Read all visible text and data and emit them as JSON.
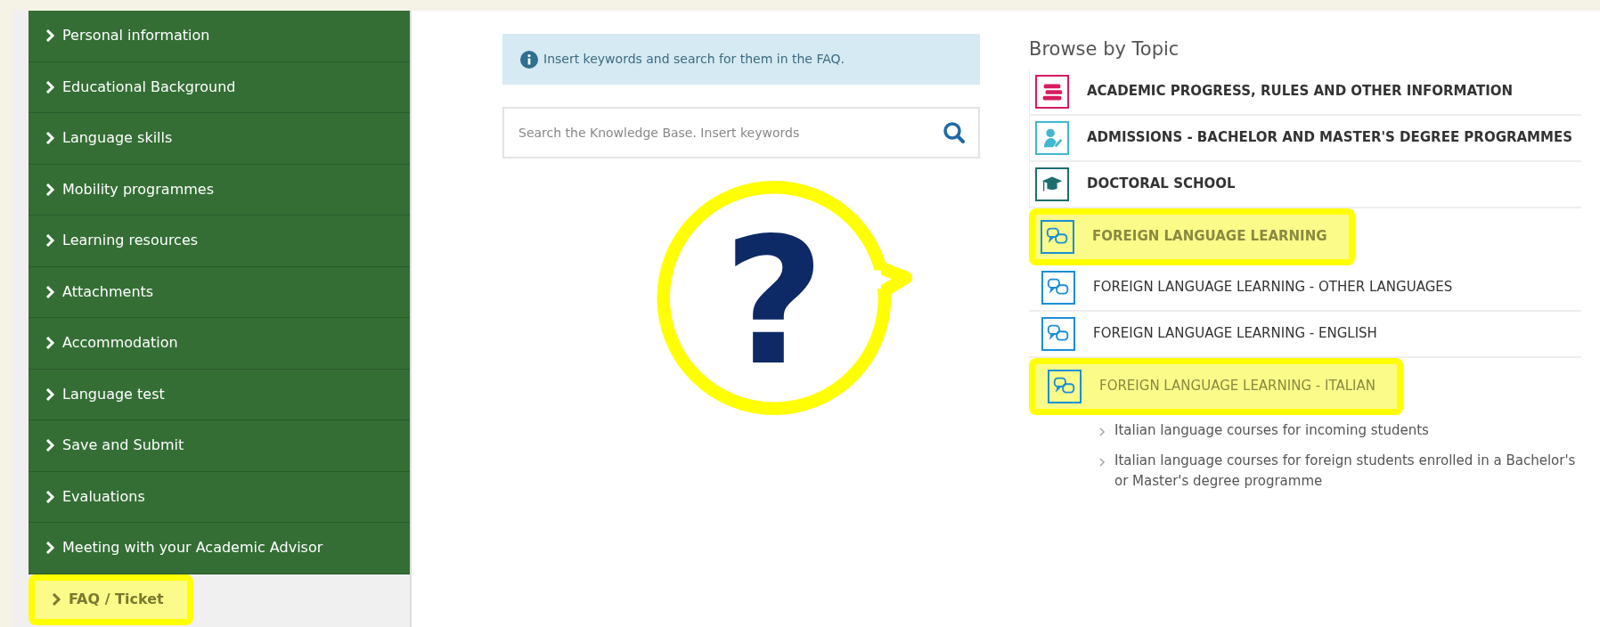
{
  "sidebar": {
    "items": [
      {
        "label": "Personal information",
        "selected": false,
        "highlighted": false
      },
      {
        "label": "Educational Background",
        "selected": false,
        "highlighted": false
      },
      {
        "label": "Language skills",
        "selected": false,
        "highlighted": false
      },
      {
        "label": "Mobility programmes",
        "selected": false,
        "highlighted": false
      },
      {
        "label": "Learning resources",
        "selected": false,
        "highlighted": false
      },
      {
        "label": "Attachments",
        "selected": false,
        "highlighted": false
      },
      {
        "label": "Accommodation",
        "selected": false,
        "highlighted": false
      },
      {
        "label": "Language test",
        "selected": false,
        "highlighted": false
      },
      {
        "label": "Save and Submit",
        "selected": false,
        "highlighted": false
      },
      {
        "label": "Evaluations",
        "selected": false,
        "highlighted": false
      },
      {
        "label": "Meeting with your Academic Advisor",
        "selected": false,
        "highlighted": false
      },
      {
        "label": "FAQ / Ticket",
        "selected": true,
        "highlighted": true
      }
    ]
  },
  "info_alert": {
    "text": "Insert keywords and search for them in the FAQ."
  },
  "search": {
    "placeholder": "Search the Knowledge Base. Insert keywords"
  },
  "annotation": {
    "text": "?"
  },
  "browse": {
    "title": "Browse by Topic",
    "topics": [
      {
        "label": "ACADEMIC PROGRESS, RULES AND OTHER INFORMATION",
        "kind": "books",
        "color": "#d81b60",
        "highlighted": false
      },
      {
        "label": "ADMISSIONS - BACHELOR AND MASTER'S DEGREE PROGRAMMES",
        "kind": "person",
        "color": "#3fb8d0",
        "highlighted": false
      },
      {
        "label": "DOCTORAL SCHOOL",
        "kind": "graduation",
        "color": "#1f6f6f",
        "highlighted": false
      },
      {
        "label": "FOREIGN LANGUAGE LEARNING",
        "kind": "speech",
        "color": "#1a8fd6",
        "highlighted": true,
        "children": [
          {
            "label": "FOREIGN LANGUAGE LEARNING - OTHER LANGUAGES",
            "kind": "speech",
            "color": "#1a8fd6",
            "highlighted": false
          },
          {
            "label": "FOREIGN LANGUAGE LEARNING - ENGLISH",
            "kind": "speech",
            "color": "#1a8fd6",
            "highlighted": false
          },
          {
            "label": "FOREIGN LANGUAGE LEARNING - ITALIAN",
            "kind": "speech",
            "color": "#1a8fd6",
            "highlighted": true,
            "articles": [
              "Italian language courses for incoming students",
              "Italian language courses for foreign students enrolled in a Bachelor's or Master's degree programme"
            ]
          }
        ]
      }
    ]
  }
}
